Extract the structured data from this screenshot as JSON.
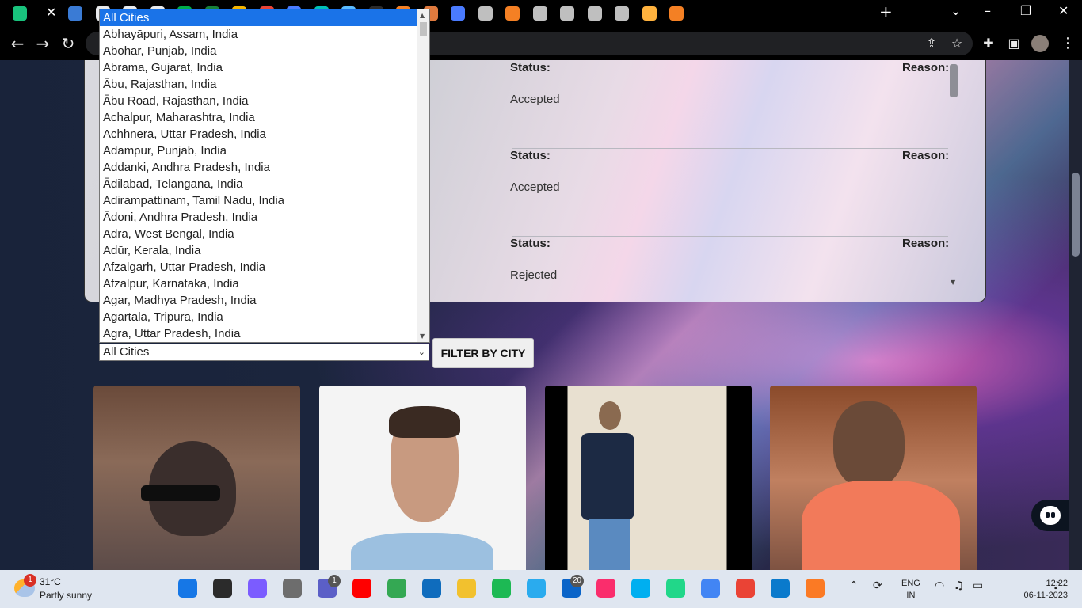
{
  "browser": {
    "tab_close_glyph": "✕",
    "new_tab_glyph": "+",
    "tab_icons": [
      "chatgpt-icon",
      "image-icon",
      "google-icon",
      "google-icon",
      "google-icon",
      "meet-icon",
      "sheets-icon",
      "slides-icon",
      "gmail-icon",
      "flag-icon",
      "drive-icon",
      "scan-icon",
      "bing-icon",
      "stack-icon",
      "cup-icon",
      "scan-icon",
      "web-icon",
      "stack-icon",
      "puzzle-icon",
      "web-icon",
      "web-icon",
      "web-icon",
      "vite-icon",
      "stack-icon"
    ]
  },
  "toolbar": {
    "back": "←",
    "forward": "→",
    "reload": "↻"
  },
  "panel": {
    "status_label": "Status:",
    "reason_label": "Reason:",
    "rows": [
      {
        "status": "Accepted"
      },
      {
        "status": "Accepted"
      },
      {
        "status": "Rejected"
      }
    ]
  },
  "filter": {
    "selected": "All Cities",
    "button_label": "FILTER BY CITY",
    "options": [
      "All Cities",
      "Abhayāpuri, Assam, India",
      "Abohar, Punjab, India",
      "Abrama, Gujarat, India",
      "Ābu, Rajasthan, India",
      "Ābu Road, Rajasthan, India",
      "Achalpur, Maharashtra, India",
      "Achhnera, Uttar Pradesh, India",
      "Adampur, Punjab, India",
      "Addanki, Andhra Pradesh, India",
      "Ādilābād, Telangana, India",
      "Adirampattinam, Tamil Nadu, India",
      "Ādoni, Andhra Pradesh, India",
      "Adra, West Bengal, India",
      "Adūr, Kerala, India",
      "Afzalgarh, Uttar Pradesh, India",
      "Afzalpur, Karnataka, India",
      "Agar, Madhya Pradesh, India",
      "Agartala, Tripura, India",
      "Agra, Uttar Pradesh, India"
    ]
  },
  "taskbar": {
    "weather_badge": "1",
    "temperature": "31°C",
    "weather": "Partly sunny",
    "apps": [
      {
        "name": "windows-start-icon",
        "color": "#1677e6"
      },
      {
        "name": "search-icon",
        "color": "#2b2b2b"
      },
      {
        "name": "copilot-icon",
        "color": "#7b5cff"
      },
      {
        "name": "task-view-icon",
        "color": "#6d6d6d"
      },
      {
        "name": "teams-icon",
        "color": "#5b5fc7"
      },
      {
        "name": "youtube-icon",
        "color": "#ff0000"
      },
      {
        "name": "chrome-icon",
        "color": "#34a853"
      },
      {
        "name": "store-icon",
        "color": "#0f6cbd"
      },
      {
        "name": "explorer-icon",
        "color": "#f2c12e"
      },
      {
        "name": "spotify-icon",
        "color": "#1db954"
      },
      {
        "name": "telegram-icon",
        "color": "#2aabee"
      },
      {
        "name": "mail-icon",
        "color": "#0a64c8"
      },
      {
        "name": "itunes-icon",
        "color": "#fa2d6c"
      },
      {
        "name": "skype-icon",
        "color": "#00aff0"
      },
      {
        "name": "pycharm-icon",
        "color": "#21d789"
      },
      {
        "name": "chrome-icon",
        "color": "#4285f4"
      },
      {
        "name": "chrome-icon",
        "color": "#ea4335"
      },
      {
        "name": "vscode-icon",
        "color": "#0a7acc"
      },
      {
        "name": "xampp-icon",
        "color": "#fb7a24"
      }
    ],
    "teams_badge": "1",
    "mail_badge": "20",
    "lang_line1": "ENG",
    "lang_line2": "IN",
    "time": "12:22",
    "date": "06-11-2023"
  },
  "colors": {
    "accent": "#1a73e8",
    "chrome_bg": "#000000",
    "taskbar_bg": "#dfe6f0"
  }
}
